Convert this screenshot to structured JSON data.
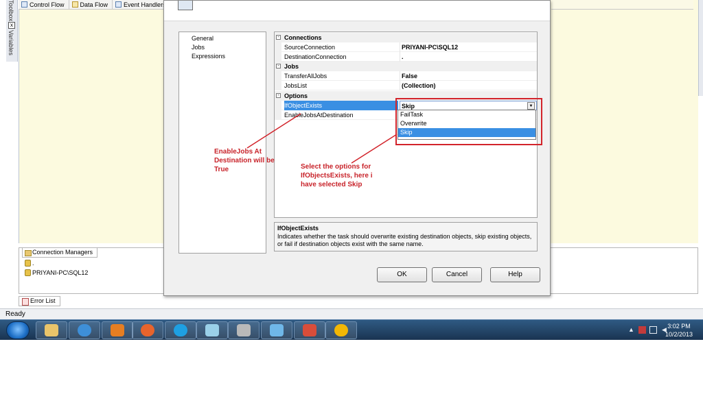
{
  "designer": {
    "tabs": [
      {
        "label": "Control Flow"
      },
      {
        "label": "Data Flow"
      },
      {
        "label": "Event Handlers"
      }
    ],
    "left_dock": {
      "toolbox_label": "Toolbox",
      "variables_label": "Variables"
    }
  },
  "connection_managers": {
    "tab_label": "Connection Managers",
    "items": [
      ".",
      "PRIYANI-PC\\SQL12"
    ]
  },
  "error_list": {
    "label": "Error List"
  },
  "status_bar": {
    "text": "Ready"
  },
  "dialog": {
    "nav_items": [
      "General",
      "Jobs",
      "Expressions"
    ],
    "property_grid": {
      "categories": [
        {
          "name": "Connections",
          "toggle": "-",
          "rows": [
            {
              "name": "SourceConnection",
              "value": "PRIYANI-PC\\SQL12"
            },
            {
              "name": "DestinationConnection",
              "value": "."
            }
          ]
        },
        {
          "name": "Jobs",
          "toggle": "-",
          "rows": [
            {
              "name": "TransferAllJobs",
              "value": "False"
            },
            {
              "name": "JobsList",
              "value": "(Collection)"
            }
          ]
        },
        {
          "name": "Options",
          "toggle": "-",
          "rows": [
            {
              "name": "IfObjectExists",
              "value": "Skip"
            },
            {
              "name": "EnableJobsAtDestination",
              "value": ""
            }
          ]
        }
      ],
      "dropdown_options": [
        "FailTask",
        "Overwrite",
        "Skip"
      ],
      "dropdown_selected": "Skip"
    },
    "description": {
      "title": "IfObjectExists",
      "text": "Indicates whether the task should overwrite existing destination objects, skip existing objects, or fail if destination objects exist with the same name."
    },
    "buttons": {
      "ok": "OK",
      "cancel": "Cancel",
      "help": "Help"
    }
  },
  "annotations": {
    "enable_jobs_note": "EnableJobs At\nDestination will be\nTrue",
    "select_options_note": "Select the options for\nIfObjectsExists, here i\nhave selected Skip",
    "color": "#c8232a"
  },
  "taskbar": {
    "clock_time": "3:02 PM",
    "clock_date": "10/2/2013",
    "accent": "#1a3451"
  }
}
